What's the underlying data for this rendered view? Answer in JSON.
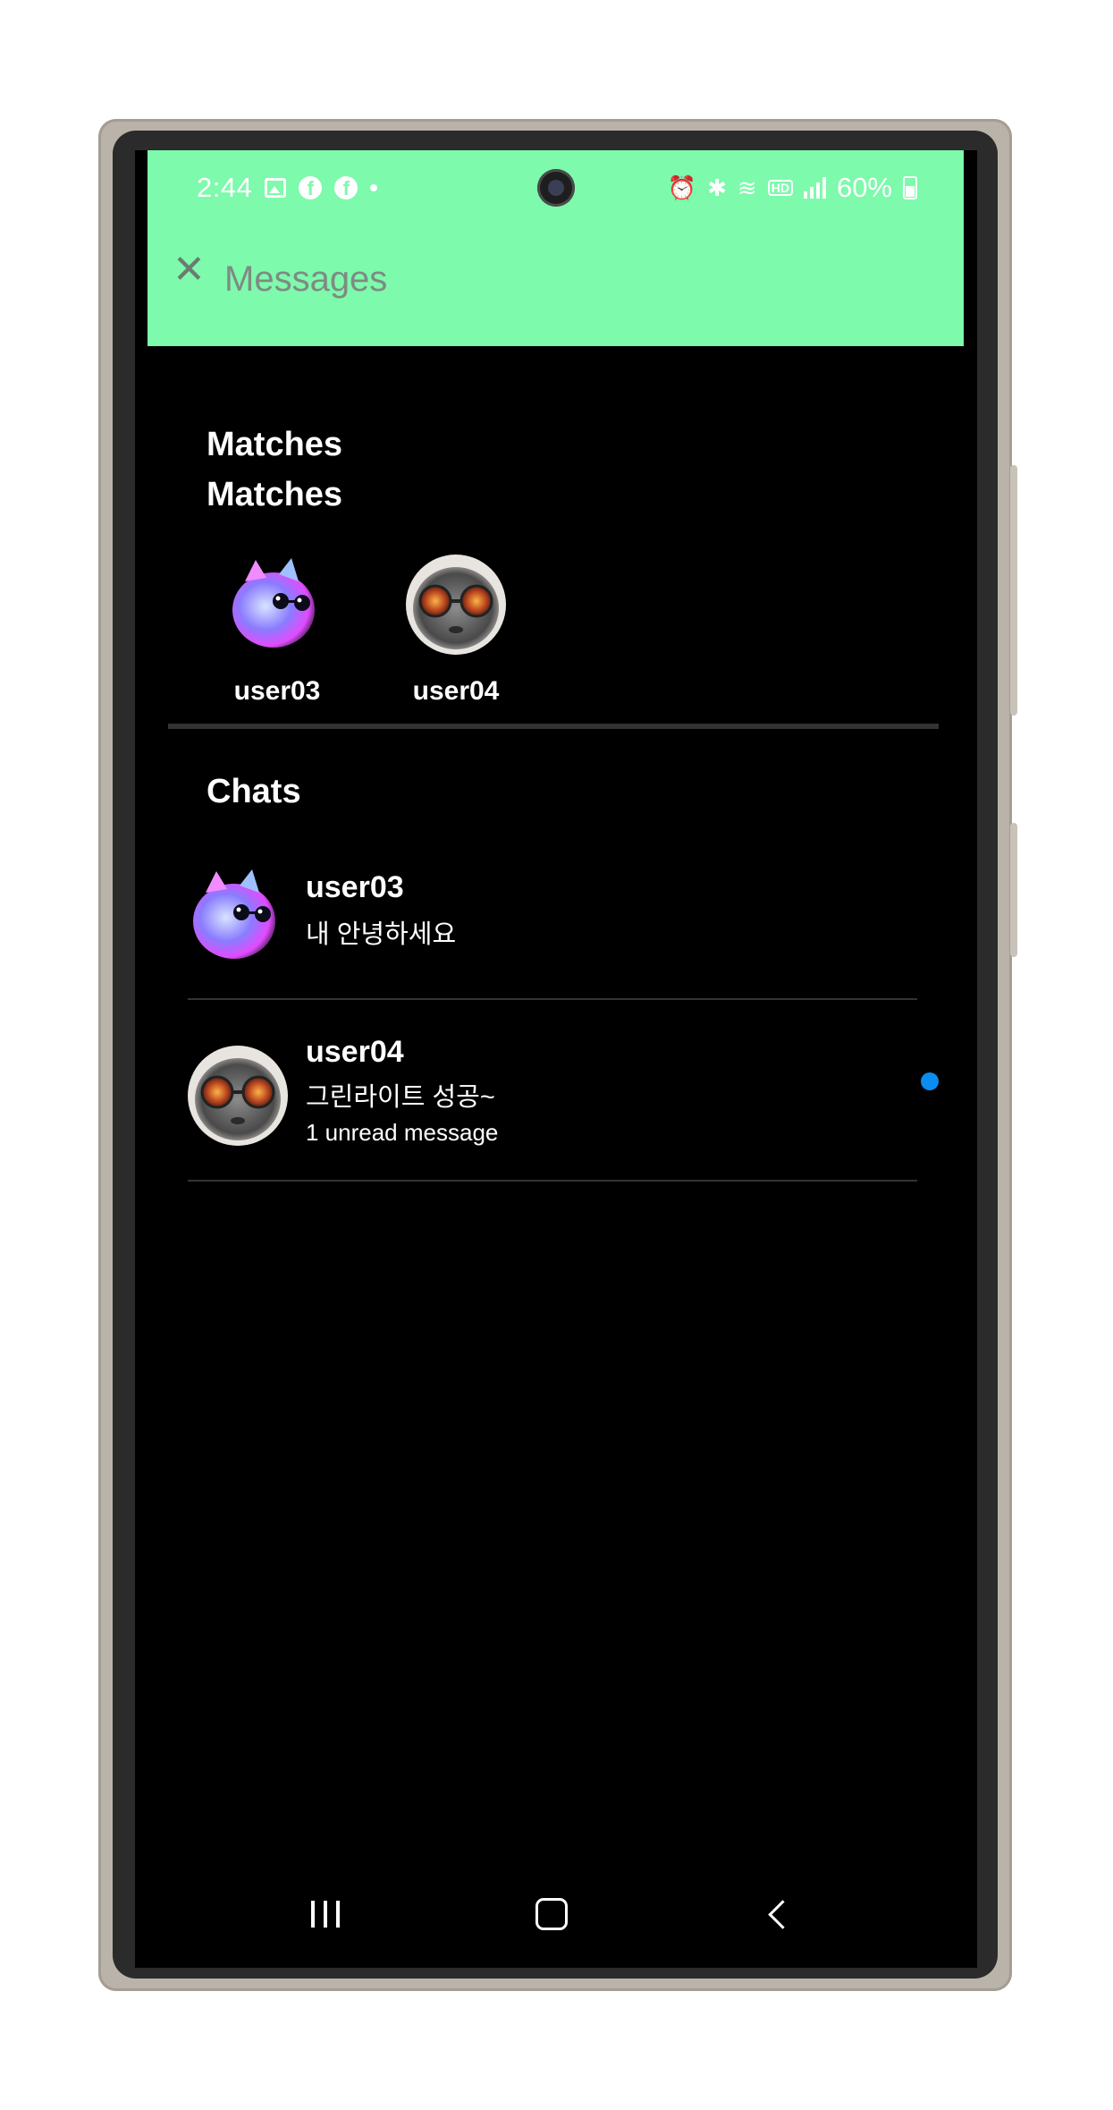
{
  "status_bar": {
    "time": "2:44",
    "battery": "60%",
    "hd_label": "HD"
  },
  "app_bar": {
    "title": "Messages",
    "close_icon": "close-icon"
  },
  "matches": {
    "title": "Matches",
    "subtitle": "Matches",
    "users": [
      {
        "name": "user03",
        "avatar": "pink-cat-with-sunglasses"
      },
      {
        "name": "user04",
        "avatar": "grey-cat-with-goggles"
      }
    ]
  },
  "chats": {
    "title": "Chats",
    "items": [
      {
        "name": "user03",
        "message": "내 안녕하세요",
        "unread_text": "",
        "unread": false
      },
      {
        "name": "user04",
        "message": "그린라이트 성공~",
        "unread_text": "1 unread message",
        "unread": true
      }
    ]
  },
  "colors": {
    "header": "#7dfaab",
    "background": "#000000",
    "unread_dot": "#0a8cf0"
  },
  "nav_bar": {
    "recents": "recents-icon",
    "home": "home-icon",
    "back": "back-icon"
  }
}
